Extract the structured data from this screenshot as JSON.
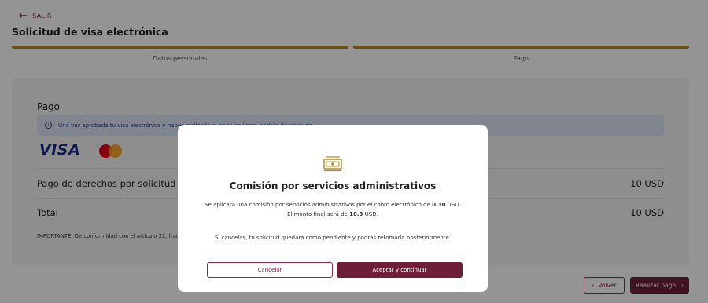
{
  "header": {
    "back_label": "SALIR",
    "title": "Solicitud de visa electrónica"
  },
  "steps": [
    {
      "label": "Datos personales"
    },
    {
      "label": "Pago"
    }
  ],
  "payment": {
    "heading": "Pago",
    "info": "Una vez aprobada tu visa electrónica y haber realizado el pago en línea, podrás descargarla.",
    "card_brands": [
      "visa-logo",
      "mastercard-logo"
    ],
    "visa_label": "VISA",
    "fee_label": "Pago de derechos por solicitud",
    "fee_value": "10 USD",
    "total_label": "Total",
    "total_value": "10 USD",
    "note": "IMPORTANTE: De conformidad con el artículo 22, fracci ... mente de su aprobación. Si su solicitud es rechazada, no procederán devoluciones."
  },
  "footer": {
    "back_label": "Volver",
    "pay_label": "Realizar pago"
  },
  "modal": {
    "icon": "money-icon",
    "title": "Comisión por servicios administrativos",
    "text_pre": "Se aplicará una comisión por servicios administrativos por el cobro electrónico de ",
    "commission": "0.30",
    "text_mid": " USD. El monto final será de ",
    "final_amount": "10.3",
    "text_post": " USD.",
    "cancel_note": "Si cancelas, tu solicitud quedará como pendiente y podrás retomarla posteriormente.",
    "cancel_label": "Cancelar",
    "accept_label": "Aceptar y continuar"
  },
  "colors": {
    "brand": "#6d1f3a",
    "progress": "#b08b22",
    "info_bg": "#dde6f6"
  }
}
